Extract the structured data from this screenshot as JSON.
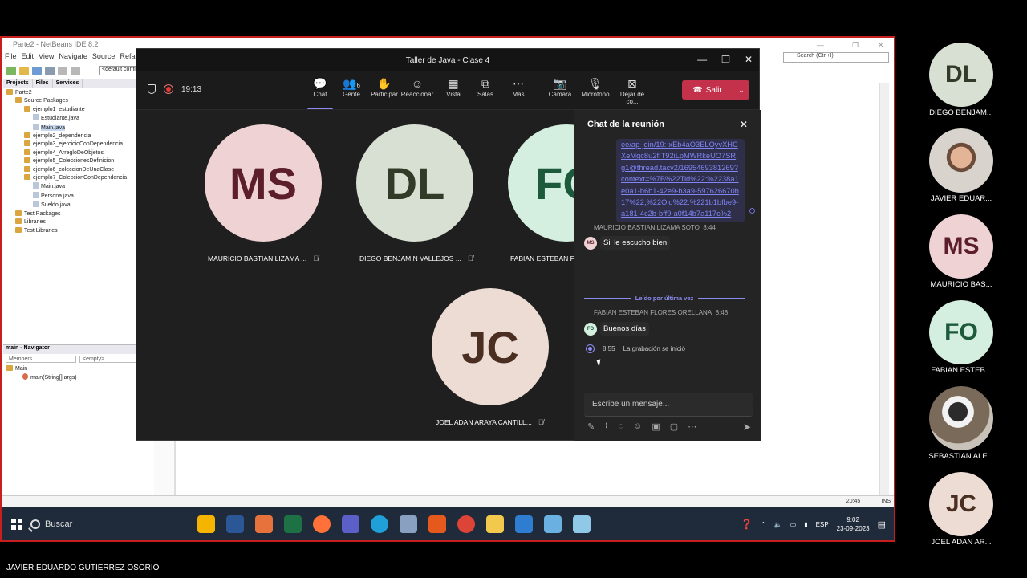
{
  "netbeans": {
    "title": "Parte2 - NetBeans IDE 8.2",
    "menu": [
      "File",
      "Edit",
      "View",
      "Navigate",
      "Source",
      "Refactor"
    ],
    "config_combo": "<default config>",
    "search_placeholder": "Search (Ctrl+I)",
    "panel_tabs": [
      "Projects",
      "Files",
      "Services"
    ],
    "tree": [
      {
        "label": "Parte2",
        "level": 0,
        "kind": "project"
      },
      {
        "label": "Source Packages",
        "level": 1,
        "kind": "folder"
      },
      {
        "label": "ejemplo1_estudiante",
        "level": 2,
        "kind": "folder"
      },
      {
        "label": "Estudiante.java",
        "level": 3,
        "kind": "file"
      },
      {
        "label": "Main.java",
        "level": 3,
        "kind": "file",
        "selected": true
      },
      {
        "label": "ejemplo2_dependencia",
        "level": 2,
        "kind": "folder"
      },
      {
        "label": "ejemplo3_ejercicioConDependencia",
        "level": 2,
        "kind": "folder"
      },
      {
        "label": "ejemplo4_ArregloDeObjetos",
        "level": 2,
        "kind": "folder"
      },
      {
        "label": "ejemplo5_ColeccionesDefinicion",
        "level": 2,
        "kind": "folder"
      },
      {
        "label": "ejemplo6_coleccionDeUnaClase",
        "level": 2,
        "kind": "folder"
      },
      {
        "label": "ejemplo7_ColeccionConDependencia",
        "level": 2,
        "kind": "folder"
      },
      {
        "label": "Main.java",
        "level": 3,
        "kind": "file"
      },
      {
        "label": "Persona.java",
        "level": 3,
        "kind": "file"
      },
      {
        "label": "Sueldo.java",
        "level": 3,
        "kind": "file"
      },
      {
        "label": "Test Packages",
        "level": 1,
        "kind": "folder"
      },
      {
        "label": "Libraries",
        "level": 1,
        "kind": "folder"
      },
      {
        "label": "Test Libraries",
        "level": 1,
        "kind": "folder"
      }
    ],
    "navigator_title": "main - Navigator",
    "navigator_members": "Members",
    "navigator_filter": "<empty>",
    "navigator_tree": [
      "Main",
      "main(String[] args)"
    ],
    "status_position": "20:45",
    "status_mode": "INS"
  },
  "taskbar": {
    "search_label": "Buscar",
    "language": "ESP",
    "time": "9:02",
    "date": "23-09-2023"
  },
  "teams": {
    "window_title": "Taller de Java - Clase 4",
    "timer": "19:13",
    "tools": [
      {
        "label": "Chat",
        "icon": "chat-icon"
      },
      {
        "label": "Gente",
        "icon": "people-icon",
        "badge": "6"
      },
      {
        "label": "Participar",
        "icon": "raise-hand-icon"
      },
      {
        "label": "Reaccionar",
        "icon": "reaction-icon"
      },
      {
        "label": "Vista",
        "icon": "view-icon"
      },
      {
        "label": "Salas",
        "icon": "rooms-icon"
      },
      {
        "label": "Más",
        "icon": "more-icon"
      },
      {
        "label": "Cámara",
        "icon": "camera-off-icon"
      },
      {
        "label": "Micrófono",
        "icon": "microphone-icon"
      },
      {
        "label": "Dejar de co...",
        "icon": "stop-share-icon"
      }
    ],
    "leave_label": "Salir",
    "participants": [
      {
        "initials": "MS",
        "name": "MAURICIO BASTIAN LIZAMA ...",
        "bg": "#efd3d4",
        "fg": "#5b1e2a"
      },
      {
        "initials": "DL",
        "name": "DIEGO BENJAMIN VALLEJOS ...",
        "bg": "#d8dfd3",
        "fg": "#323b28"
      },
      {
        "initials": "FO",
        "name": "FABIAN ESTEBAN FL",
        "bg": "#d4eee0",
        "fg": "#1d5a3c"
      },
      {
        "initials": "JC",
        "name": "JOEL ADAN ARAYA CANTILL...",
        "bg": "#ecdcd4",
        "fg": "#4a2e22"
      }
    ],
    "chat": {
      "title": "Chat de la reunión",
      "link_text": "ee/ap-join/19:-xEb4aO3ELOyvXHCXeMgc8u2fIT92iLpMWRkeUO7SRg1@thread.tacv2/1695469381269?context=%7B%22Tid%22:%2238a1e0a1-b6b1-42e9-b3a9-597626670b17%22,%22Oid%22:%221b1bfbe9-a181-4c2b-bff9-a0f14b7a117c%22%7D",
      "messages": [
        {
          "sender": "MAURICIO BASTIAN LIZAMA SOTO",
          "time": "8:44",
          "initials": "MS",
          "text": "Sii le escucho bien"
        },
        {
          "sender": "FABIAN ESTEBAN FLORES ORELLANA",
          "time": "8:48",
          "initials": "FO",
          "text": "Buenos días"
        }
      ],
      "read_marker": "Leído por última vez",
      "recording_time": "8:55",
      "recording_text": "La grabación se inició",
      "compose_placeholder": "Escribe un mensaje..."
    }
  },
  "right_panel": [
    {
      "initials": "DL",
      "name": "DIEGO BENJAM...",
      "kind": "avatar",
      "bg": "#d8dfd3",
      "fg": "#323b28"
    },
    {
      "initials": "",
      "name": "JAVIER EDUAR...",
      "kind": "photo"
    },
    {
      "initials": "MS",
      "name": "MAURICIO BAS...",
      "kind": "avatar",
      "bg": "#efd3d4",
      "fg": "#5b1e2a"
    },
    {
      "initials": "FO",
      "name": "FABIAN ESTEB...",
      "kind": "avatar",
      "bg": "#d4eee0",
      "fg": "#1d5a3c"
    },
    {
      "initials": "",
      "name": "SEBASTIAN ALE...",
      "kind": "photo"
    },
    {
      "initials": "JC",
      "name": "JOEL ADAN AR...",
      "kind": "avatar",
      "bg": "#ecdcd4",
      "fg": "#4a2e22"
    }
  ],
  "presenter_name": "JAVIER EDUARDO GUTIERREZ OSORIO"
}
